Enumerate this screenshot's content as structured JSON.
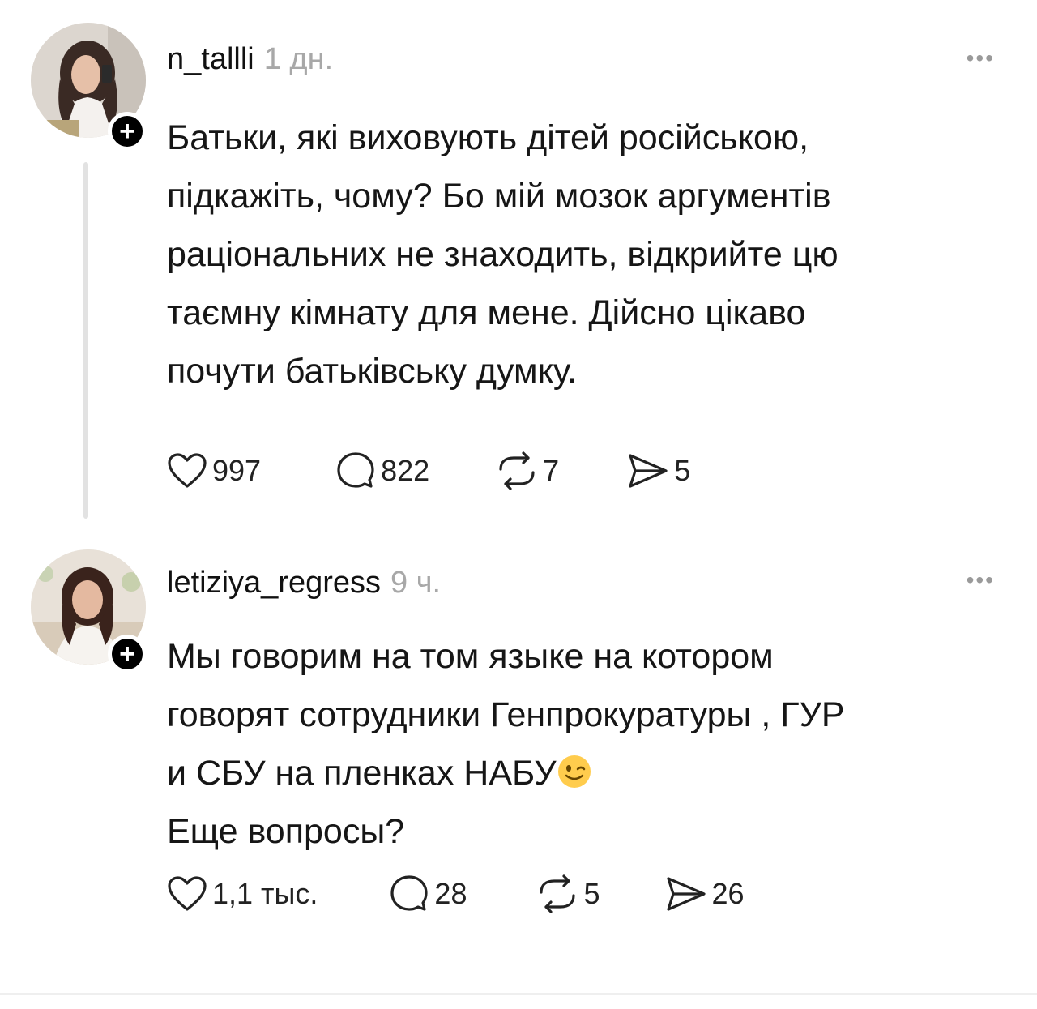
{
  "posts": [
    {
      "username": "n_tallli",
      "time": "1 дн.",
      "text": "Батьки, які виховують дітей російською,\nпідкажіть, чому? Бо мій мозок аргументів\nраціональних не знаходить, відкрийте цю\nтаємну кімнату для мене. Дійсно цікаво\nпочути батьківську думку.",
      "likes": "997",
      "replies": "822",
      "reposts": "7",
      "shares": "5",
      "more": "•••"
    },
    {
      "username": "letiziya_regress",
      "time": "9 ч.",
      "text_lines": [
        "Мы говорим на том языке на котором",
        "говорят сотрудники Генпрокуратуры , ГУР",
        "и СБУ на пленках НАБУ",
        "Еще вопросы?"
      ],
      "emoji": "winking-face",
      "likes": "1,1 тыс.",
      "replies": "28",
      "reposts": "5",
      "shares": "26",
      "more": "•••"
    }
  ],
  "follow_symbol": "+",
  "colors": {
    "text": "#161616",
    "muted": "#a8a8a8",
    "thread_line": "#e2e2e2",
    "badge": "#000000"
  }
}
